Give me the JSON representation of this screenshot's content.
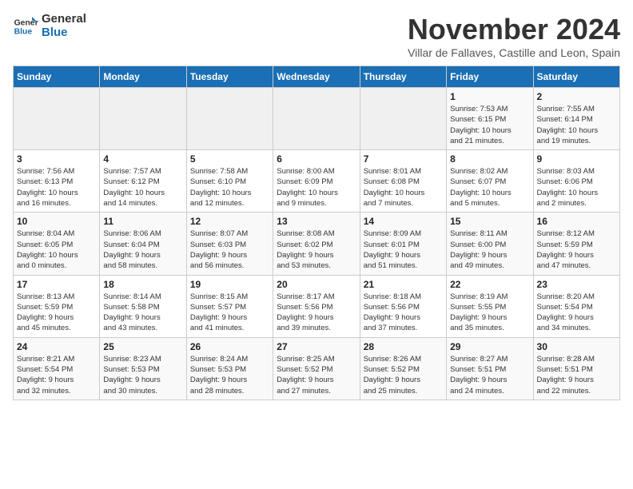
{
  "header": {
    "logo_general": "General",
    "logo_blue": "Blue",
    "month_title": "November 2024",
    "subtitle": "Villar de Fallaves, Castille and Leon, Spain"
  },
  "weekdays": [
    "Sunday",
    "Monday",
    "Tuesday",
    "Wednesday",
    "Thursday",
    "Friday",
    "Saturday"
  ],
  "weeks": [
    [
      {
        "day": "",
        "info": ""
      },
      {
        "day": "",
        "info": ""
      },
      {
        "day": "",
        "info": ""
      },
      {
        "day": "",
        "info": ""
      },
      {
        "day": "",
        "info": ""
      },
      {
        "day": "1",
        "info": "Sunrise: 7:53 AM\nSunset: 6:15 PM\nDaylight: 10 hours\nand 21 minutes."
      },
      {
        "day": "2",
        "info": "Sunrise: 7:55 AM\nSunset: 6:14 PM\nDaylight: 10 hours\nand 19 minutes."
      }
    ],
    [
      {
        "day": "3",
        "info": "Sunrise: 7:56 AM\nSunset: 6:13 PM\nDaylight: 10 hours\nand 16 minutes."
      },
      {
        "day": "4",
        "info": "Sunrise: 7:57 AM\nSunset: 6:12 PM\nDaylight: 10 hours\nand 14 minutes."
      },
      {
        "day": "5",
        "info": "Sunrise: 7:58 AM\nSunset: 6:10 PM\nDaylight: 10 hours\nand 12 minutes."
      },
      {
        "day": "6",
        "info": "Sunrise: 8:00 AM\nSunset: 6:09 PM\nDaylight: 10 hours\nand 9 minutes."
      },
      {
        "day": "7",
        "info": "Sunrise: 8:01 AM\nSunset: 6:08 PM\nDaylight: 10 hours\nand 7 minutes."
      },
      {
        "day": "8",
        "info": "Sunrise: 8:02 AM\nSunset: 6:07 PM\nDaylight: 10 hours\nand 5 minutes."
      },
      {
        "day": "9",
        "info": "Sunrise: 8:03 AM\nSunset: 6:06 PM\nDaylight: 10 hours\nand 2 minutes."
      }
    ],
    [
      {
        "day": "10",
        "info": "Sunrise: 8:04 AM\nSunset: 6:05 PM\nDaylight: 10 hours\nand 0 minutes."
      },
      {
        "day": "11",
        "info": "Sunrise: 8:06 AM\nSunset: 6:04 PM\nDaylight: 9 hours\nand 58 minutes."
      },
      {
        "day": "12",
        "info": "Sunrise: 8:07 AM\nSunset: 6:03 PM\nDaylight: 9 hours\nand 56 minutes."
      },
      {
        "day": "13",
        "info": "Sunrise: 8:08 AM\nSunset: 6:02 PM\nDaylight: 9 hours\nand 53 minutes."
      },
      {
        "day": "14",
        "info": "Sunrise: 8:09 AM\nSunset: 6:01 PM\nDaylight: 9 hours\nand 51 minutes."
      },
      {
        "day": "15",
        "info": "Sunrise: 8:11 AM\nSunset: 6:00 PM\nDaylight: 9 hours\nand 49 minutes."
      },
      {
        "day": "16",
        "info": "Sunrise: 8:12 AM\nSunset: 5:59 PM\nDaylight: 9 hours\nand 47 minutes."
      }
    ],
    [
      {
        "day": "17",
        "info": "Sunrise: 8:13 AM\nSunset: 5:59 PM\nDaylight: 9 hours\nand 45 minutes."
      },
      {
        "day": "18",
        "info": "Sunrise: 8:14 AM\nSunset: 5:58 PM\nDaylight: 9 hours\nand 43 minutes."
      },
      {
        "day": "19",
        "info": "Sunrise: 8:15 AM\nSunset: 5:57 PM\nDaylight: 9 hours\nand 41 minutes."
      },
      {
        "day": "20",
        "info": "Sunrise: 8:17 AM\nSunset: 5:56 PM\nDaylight: 9 hours\nand 39 minutes."
      },
      {
        "day": "21",
        "info": "Sunrise: 8:18 AM\nSunset: 5:56 PM\nDaylight: 9 hours\nand 37 minutes."
      },
      {
        "day": "22",
        "info": "Sunrise: 8:19 AM\nSunset: 5:55 PM\nDaylight: 9 hours\nand 35 minutes."
      },
      {
        "day": "23",
        "info": "Sunrise: 8:20 AM\nSunset: 5:54 PM\nDaylight: 9 hours\nand 34 minutes."
      }
    ],
    [
      {
        "day": "24",
        "info": "Sunrise: 8:21 AM\nSunset: 5:54 PM\nDaylight: 9 hours\nand 32 minutes."
      },
      {
        "day": "25",
        "info": "Sunrise: 8:23 AM\nSunset: 5:53 PM\nDaylight: 9 hours\nand 30 minutes."
      },
      {
        "day": "26",
        "info": "Sunrise: 8:24 AM\nSunset: 5:53 PM\nDaylight: 9 hours\nand 28 minutes."
      },
      {
        "day": "27",
        "info": "Sunrise: 8:25 AM\nSunset: 5:52 PM\nDaylight: 9 hours\nand 27 minutes."
      },
      {
        "day": "28",
        "info": "Sunrise: 8:26 AM\nSunset: 5:52 PM\nDaylight: 9 hours\nand 25 minutes."
      },
      {
        "day": "29",
        "info": "Sunrise: 8:27 AM\nSunset: 5:51 PM\nDaylight: 9 hours\nand 24 minutes."
      },
      {
        "day": "30",
        "info": "Sunrise: 8:28 AM\nSunset: 5:51 PM\nDaylight: 9 hours\nand 22 minutes."
      }
    ]
  ]
}
